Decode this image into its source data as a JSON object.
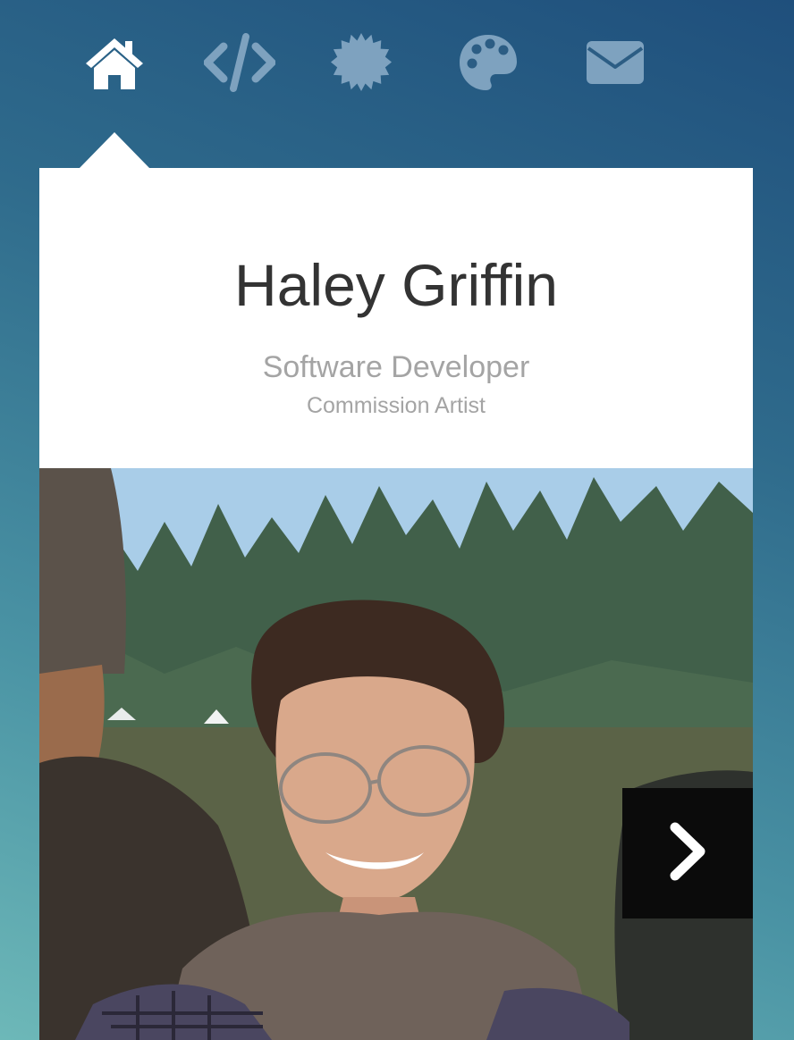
{
  "nav": {
    "items": [
      {
        "icon": "home-icon",
        "active": true
      },
      {
        "icon": "code-icon",
        "active": false
      },
      {
        "icon": "badge-icon",
        "active": false
      },
      {
        "icon": "palette-icon",
        "active": false
      },
      {
        "icon": "envelope-icon",
        "active": false
      }
    ],
    "active_color": "#ffffff",
    "inactive_color": "#7ea2bf"
  },
  "profile": {
    "name": "Haley Griffin",
    "title": "Software Developer",
    "subtitle": "Commission Artist"
  },
  "carousel": {
    "next_icon": "chevron-right-icon"
  }
}
